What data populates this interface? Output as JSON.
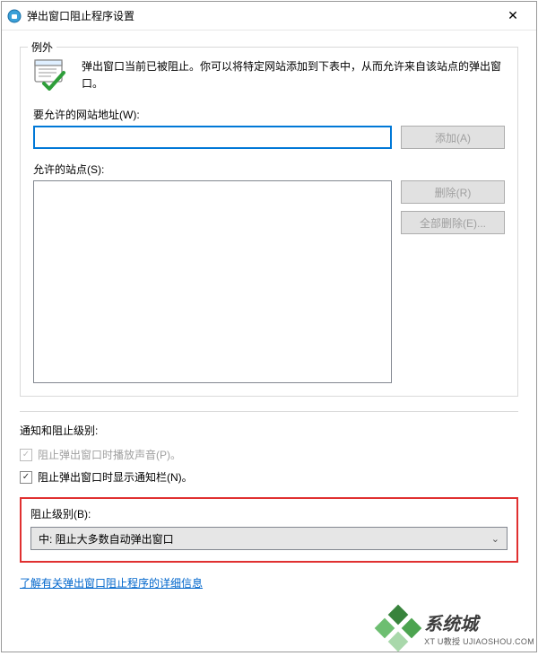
{
  "titlebar": {
    "title": "弹出窗口阻止程序设置",
    "close": "✕"
  },
  "exceptions": {
    "group_title": "例外",
    "info_text": "弹出窗口当前已被阻止。你可以将特定网站添加到下表中，从而允许来自该站点的弹出窗口。",
    "address_label": "要允许的网站地址(W):",
    "add_button": "添加(A)",
    "allowed_label": "允许的站点(S):",
    "remove_button": "删除(R)",
    "remove_all_button": "全部删除(E)..."
  },
  "notify": {
    "section_title": "通知和阻止级别:",
    "play_sound": "阻止弹出窗口时播放声音(P)。",
    "show_bar": "阻止弹出窗口时显示通知栏(N)。"
  },
  "blocking": {
    "label": "阻止级别(B):",
    "selected": "中: 阻止大多数自动弹出窗口"
  },
  "link": {
    "text": "了解有关弹出窗口阻止程序的详细信息"
  },
  "watermark": {
    "cn": "系统城",
    "en": "XT U教授 UJIAOSHOU.COM"
  }
}
